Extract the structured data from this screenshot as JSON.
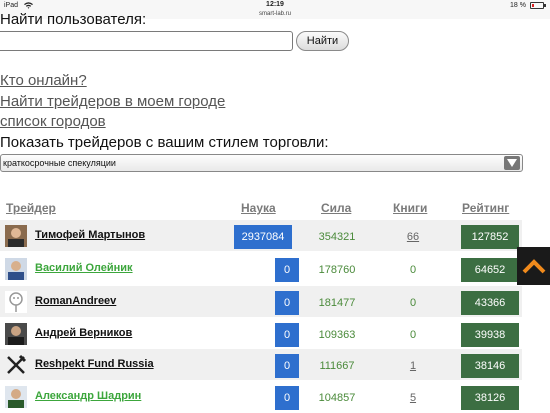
{
  "status_bar": {
    "device": "iPad",
    "time": "12:19",
    "battery_pct": "18 %",
    "battery_level": 0.18,
    "url": "smart-lab.ru"
  },
  "search": {
    "label": "Найти пользователя:",
    "input_value": "",
    "button_label": "Найти"
  },
  "links": {
    "online": "Кто онлайн?",
    "find_city": "Найти трейдеров в моем городе",
    "city_list": "список городов"
  },
  "style_filter": {
    "label": "Показать трейдеров с вашим стилем торговли:",
    "selected": "краткосрочные спекуляции"
  },
  "table": {
    "headers": {
      "trader": "Трейдер",
      "nauka": "Наука",
      "sila": "Сила",
      "knigi": "Книги",
      "rating": "Рейтинг"
    },
    "rows": [
      {
        "name": "Тимофей Мартынов",
        "name_color": "black",
        "avatar_icon": "person-photo-icon",
        "nauka": "2937084",
        "sila": "354321",
        "knigi": "66",
        "knigi_link": true,
        "rating": "127852"
      },
      {
        "name": "Василий Олейник",
        "name_color": "green",
        "avatar_icon": "person-photo-icon",
        "nauka": "0",
        "sila": "178760",
        "knigi": "0",
        "knigi_link": false,
        "rating": "64652"
      },
      {
        "name": "RomanAndreev",
        "name_color": "black",
        "avatar_icon": "default-avatar-icon",
        "nauka": "0",
        "sila": "181477",
        "knigi": "0",
        "knigi_link": false,
        "rating": "43366"
      },
      {
        "name": "Андрей Верников",
        "name_color": "black",
        "avatar_icon": "person-photo-icon",
        "nauka": "0",
        "sila": "109363",
        "knigi": "0",
        "knigi_link": false,
        "rating": "39938"
      },
      {
        "name": "Reshpekt Fund Russia",
        "name_color": "black",
        "avatar_icon": "fork-knife-icon",
        "nauka": "0",
        "sila": "111667",
        "knigi": "1",
        "knigi_link": true,
        "rating": "38146"
      },
      {
        "name": "Александр Шадрин",
        "name_color": "green",
        "avatar_icon": "person-photo-icon",
        "nauka": "0",
        "sila": "104857",
        "knigi": "5",
        "knigi_link": true,
        "rating": "38126"
      }
    ]
  },
  "colors": {
    "nauka_blue": "#2e6fce",
    "rating_green": "#3c6e42",
    "sila_green": "#4a8a3a",
    "scroll_accent": "#f08a1c"
  },
  "scroll_button_icon": "chevron-up-icon"
}
